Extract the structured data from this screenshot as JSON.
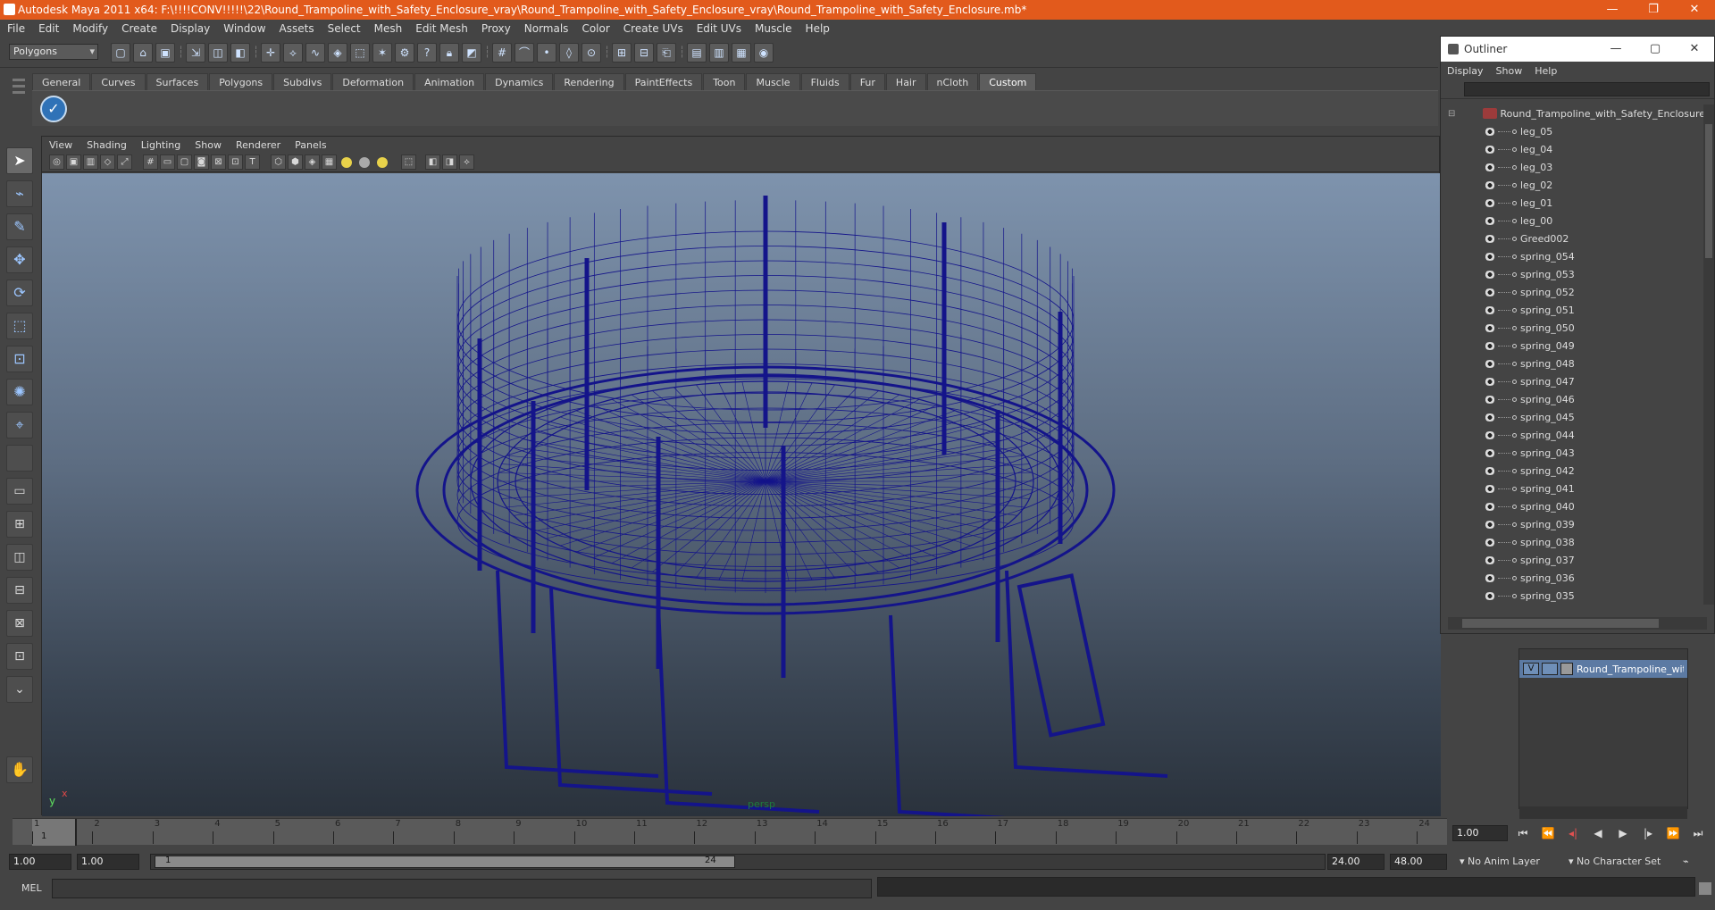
{
  "titlebar": {
    "title": "Autodesk Maya 2011 x64: F:\\!!!!CONV!!!!!\\22\\Round_Trampoline_with_Safety_Enclosure_vray\\Round_Trampoline_with_Safety_Enclosure_vray\\Round_Trampoline_with_Safety_Enclosure.mb*",
    "minimize": "—",
    "restore": "❐",
    "close": "✕"
  },
  "menubar": [
    "File",
    "Edit",
    "Modify",
    "Create",
    "Display",
    "Window",
    "Assets",
    "Select",
    "Mesh",
    "Edit Mesh",
    "Proxy",
    "Normals",
    "Color",
    "Create UVs",
    "Edit UVs",
    "Muscle",
    "Help"
  ],
  "statusline": {
    "mode": "Polygons",
    "icons": [
      "new-scene-icon",
      "open-scene-icon",
      "save-scene-icon",
      "select-hierarchy-icon",
      "select-object-icon",
      "select-component-icon",
      "snap-grid-icon",
      "snap-curve-icon",
      "snap-point-icon",
      "snap-plane-icon",
      "snap-live-icon",
      "history-icon",
      "render-icon",
      "ipr-icon",
      "render-settings-icon",
      "hypershade-icon"
    ]
  },
  "shelf": {
    "tabs": [
      "General",
      "Curves",
      "Surfaces",
      "Polygons",
      "Subdivs",
      "Deformation",
      "Animation",
      "Dynamics",
      "Rendering",
      "PaintEffects",
      "Toon",
      "Muscle",
      "Fluids",
      "Fur",
      "Hair",
      "nCloth",
      "Custom"
    ],
    "active_tab": "Custom"
  },
  "viewport": {
    "menus": [
      "View",
      "Shading",
      "Lighting",
      "Show",
      "Renderer",
      "Panels"
    ],
    "camera": "persp",
    "axis_y": "y",
    "axis_x": "x",
    "wire_color": "#14148a"
  },
  "outliner": {
    "title": "Outliner",
    "menus": [
      "Display",
      "Show",
      "Help"
    ],
    "filter": "",
    "root": "Round_Trampoline_with_Safety_Enclosure",
    "items": [
      "leg_05",
      "leg_04",
      "leg_03",
      "leg_02",
      "leg_01",
      "leg_00",
      "Greed002",
      "spring_054",
      "spring_053",
      "spring_052",
      "spring_051",
      "spring_050",
      "spring_049",
      "spring_048",
      "spring_047",
      "spring_046",
      "spring_045",
      "spring_044",
      "spring_043",
      "spring_042",
      "spring_041",
      "spring_040",
      "spring_039",
      "spring_038",
      "spring_037",
      "spring_036",
      "spring_035"
    ]
  },
  "layers": {
    "layer_name": "Round_Trampoline_with_",
    "visible_flag": "V"
  },
  "timeslider": {
    "ticks": [
      "1",
      "2",
      "3",
      "4",
      "5",
      "6",
      "7",
      "8",
      "9",
      "10",
      "11",
      "12",
      "13",
      "14",
      "15",
      "16",
      "17",
      "18",
      "19",
      "20",
      "21",
      "22",
      "23",
      "24"
    ],
    "current_frame": "1",
    "current_time": "1.00"
  },
  "range": {
    "start_time": "1.00",
    "start_range": "1.00",
    "handle_start": "1",
    "handle_end": "24",
    "end_range": "24.00",
    "end_time": "48.00",
    "anim_layer": "No Anim Layer",
    "char_set": "No Character Set"
  },
  "cmdline": {
    "label": "MEL"
  }
}
